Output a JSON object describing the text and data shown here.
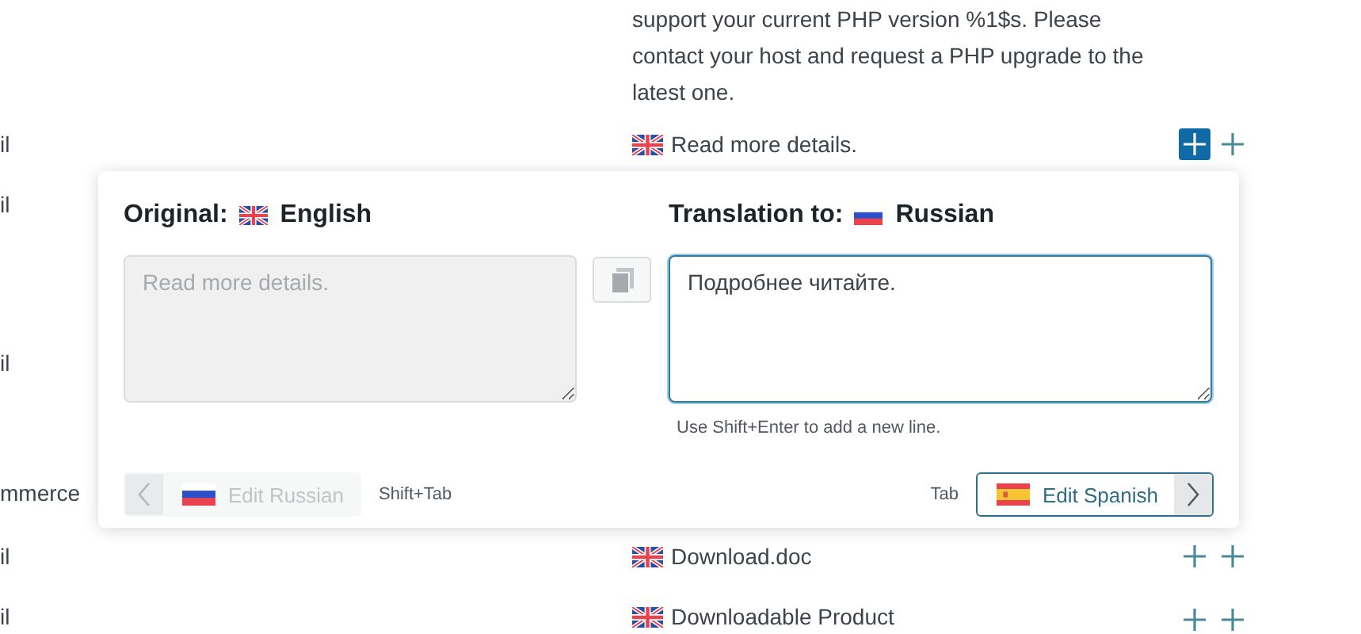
{
  "intro_text": "support your current PHP version %1$s. Please contact your host and request a PHP upgrade to the latest one.",
  "rows": [
    {
      "column_1": "il",
      "column_2": "Read more details.",
      "flag": {
        "kind": "gb"
      },
      "actions": [
        {
          "selected": true
        },
        {
          "selected": false
        }
      ]
    },
    {
      "column_1": "il"
    },
    {
      "column_1": "il"
    },
    {
      "column_1": "mmerce"
    },
    {
      "column_1": "il",
      "column_2": "Download.doc",
      "flag": {
        "kind": "gb"
      },
      "actions": [
        {
          "selected": false
        },
        {
          "selected": false
        }
      ]
    },
    {
      "column_1": "il",
      "column_2": "Downloadable Product",
      "flag": {
        "kind": "gb"
      },
      "actions": [
        {
          "selected": false
        },
        {
          "selected": false
        }
      ]
    }
  ],
  "popup": {
    "original": {
      "label": "Original:",
      "flag": {
        "kind": "gb"
      },
      "language": "English",
      "text": "Read more details.",
      "disabled": true
    },
    "translation": {
      "label": "Translation to:",
      "flag": {
        "kind": "ru"
      },
      "language": "Russian",
      "value": "Подробнее читайте.",
      "focused": true,
      "hint": "Use Shift+Enter to add a new line."
    },
    "previous": {
      "label": "Edit Russian",
      "flag": {
        "kind": "ru"
      },
      "shortcut": "Shift+Tab",
      "disabled": true
    },
    "next": {
      "label": "Edit Spanish",
      "flag": {
        "kind": "es"
      },
      "shortcut": "Tab",
      "disabled": false
    }
  }
}
